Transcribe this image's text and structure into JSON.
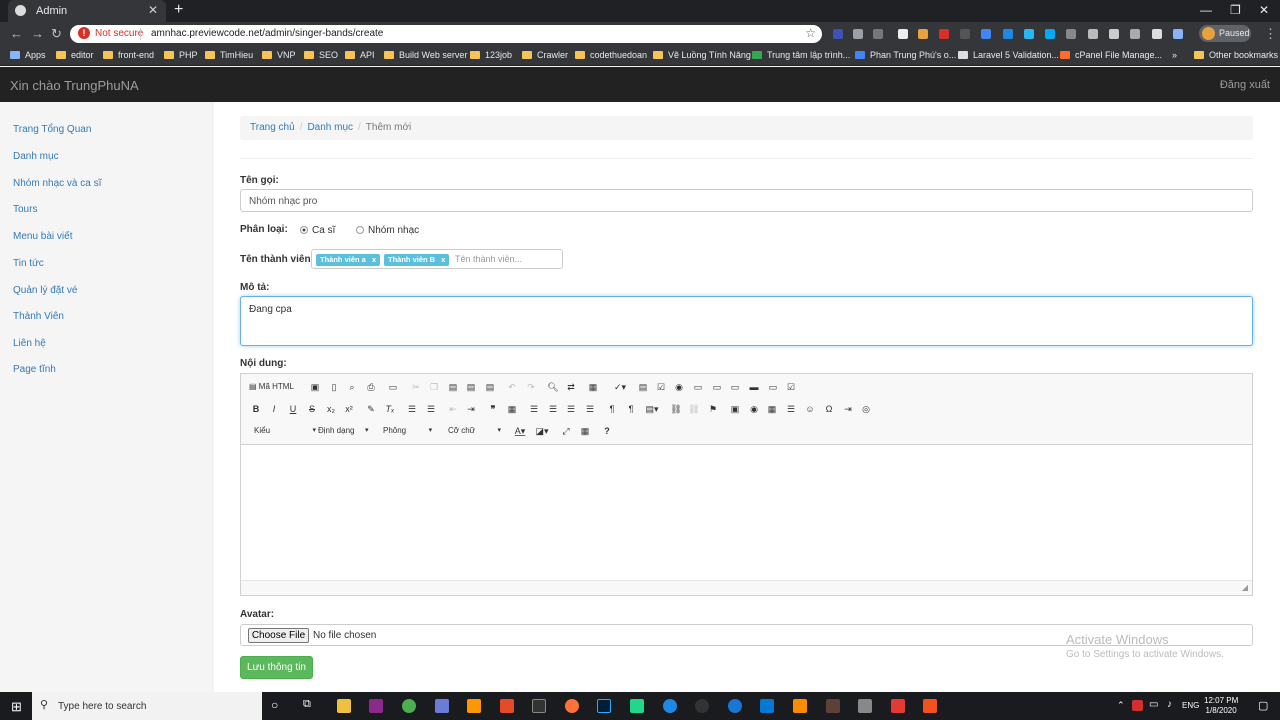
{
  "browser": {
    "tab_title": "Admin",
    "not_secure": "Not secure",
    "url": "amnhac.previewcode.net/admin/singer-bands/create",
    "paused": "Paused",
    "bookmarks": [
      "Apps",
      "editor",
      "front-end",
      "PHP",
      "TimHieu",
      "VNP",
      "SEO",
      "API",
      "Build Web server",
      "123job",
      "Crawler",
      "codethuedoan",
      "Vẽ Luồng Tính Năng",
      "Trung tâm lập trình...",
      "Phan Trung Phú's o...",
      "Laravel 5 Validation...",
      "cPanel File Manage..."
    ],
    "other_bookmarks": "Other bookmarks",
    "more": "»"
  },
  "header": {
    "welcome": "Xin chào TrungPhuNA",
    "logout": "Đăng xuất"
  },
  "sidebar": {
    "items": [
      "Trang Tổng Quan",
      "Danh mục",
      "Nhóm nhạc và ca sĩ",
      "Tours",
      "Menu bài viết",
      "Tin tức",
      "Quản lý đặt vé",
      "Thành Viên",
      "Liên hệ",
      "Page tĩnh"
    ]
  },
  "breadcrumb": {
    "items": [
      "Trang chủ",
      "Danh mục",
      "Thêm mới"
    ],
    "separator": "/"
  },
  "form": {
    "name_label": "Tên gọi:",
    "name_value": "Nhóm nhạc pro",
    "type_label": "Phân loại:",
    "type_options": [
      "Ca sĩ",
      "Nhóm nhạc"
    ],
    "type_selected": "Ca sĩ",
    "members_label": "Tên thành viên:",
    "members": [
      "Thành viên a",
      "Thành viên B"
    ],
    "members_remove": "x",
    "members_placeholder": "Tên thành viên...",
    "desc_label": "Mô tả:",
    "desc_value": "Đang cpa",
    "content_label": "Nội dung:",
    "editor": {
      "source_label": "Mã HTML",
      "combos": [
        "Kiểu",
        "Định dạng",
        "Phông",
        "Cỡ chữ"
      ]
    },
    "avatar_label": "Avatar:",
    "choose_file": "Choose File",
    "no_file": "No file chosen",
    "submit": "Lưu thông tin"
  },
  "watermark": {
    "line1": "Activate Windows",
    "line2": "Go to Settings to activate Windows."
  },
  "taskbar": {
    "search_placeholder": "Type here to search",
    "lang": "ENG",
    "time": "12:07 PM",
    "date": "1/8/2020"
  }
}
